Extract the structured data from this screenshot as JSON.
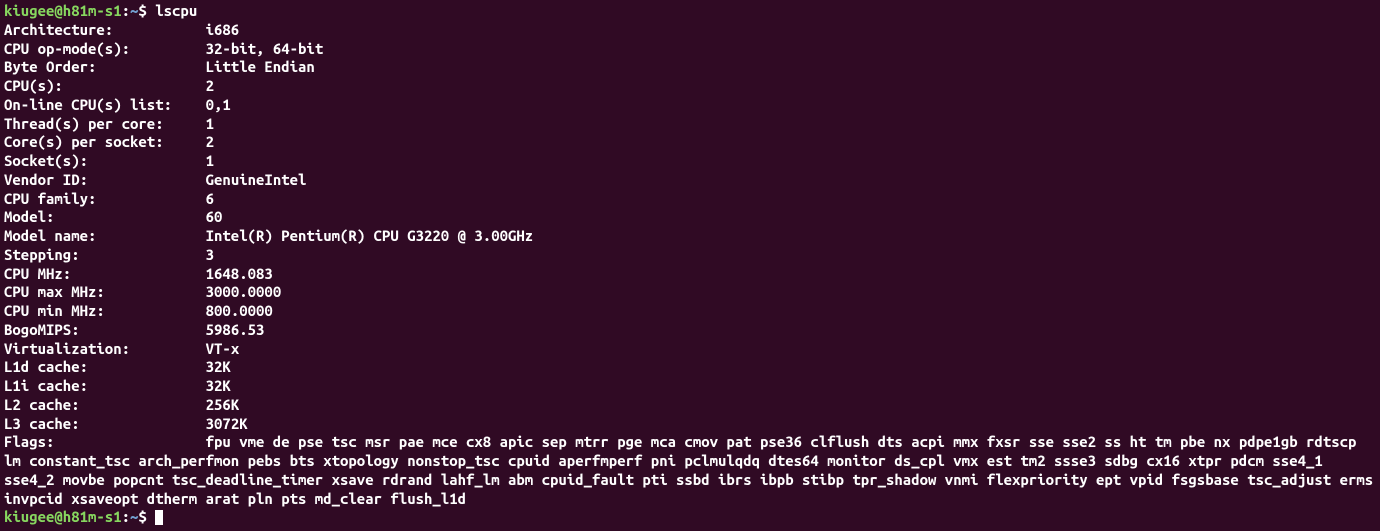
{
  "prompt": {
    "user_host": "kiugee@h81m-s1",
    "path": "~",
    "separator": ":",
    "symbol": "$"
  },
  "command": "lscpu",
  "fields": [
    {
      "label": "Architecture:",
      "value": "i686"
    },
    {
      "label": "CPU op-mode(s):",
      "value": "32-bit, 64-bit"
    },
    {
      "label": "Byte Order:",
      "value": "Little Endian"
    },
    {
      "label": "CPU(s):",
      "value": "2"
    },
    {
      "label": "On-line CPU(s) list:",
      "value": "0,1"
    },
    {
      "label": "Thread(s) per core:",
      "value": "1"
    },
    {
      "label": "Core(s) per socket:",
      "value": "2"
    },
    {
      "label": "Socket(s):",
      "value": "1"
    },
    {
      "label": "Vendor ID:",
      "value": "GenuineIntel"
    },
    {
      "label": "CPU family:",
      "value": "6"
    },
    {
      "label": "Model:",
      "value": "60"
    },
    {
      "label": "Model name:",
      "value": "Intel(R) Pentium(R) CPU G3220 @ 3.00GHz"
    },
    {
      "label": "Stepping:",
      "value": "3"
    },
    {
      "label": "CPU MHz:",
      "value": "1648.083"
    },
    {
      "label": "CPU max MHz:",
      "value": "3000.0000"
    },
    {
      "label": "CPU min MHz:",
      "value": "800.0000"
    },
    {
      "label": "BogoMIPS:",
      "value": "5986.53"
    },
    {
      "label": "Virtualization:",
      "value": "VT-x"
    },
    {
      "label": "L1d cache:",
      "value": "32K"
    },
    {
      "label": "L1i cache:",
      "value": "32K"
    },
    {
      "label": "L2 cache:",
      "value": "256K"
    },
    {
      "label": "L3 cache:",
      "value": "3072K"
    }
  ],
  "flags_label": "Flags:",
  "flags_value": "fpu vme de pse tsc msr pae mce cx8 apic sep mtrr pge mca cmov pat pse36 clflush dts acpi mmx fxsr sse sse2 ss ht tm pbe nx pdpe1gb rdtscp lm constant_tsc arch_perfmon pebs bts xtopology nonstop_tsc cpuid aperfmperf pni pclmulqdq dtes64 monitor ds_cpl vmx est tm2 ssse3 sdbg cx16 xtpr pdcm sse4_1 sse4_2 movbe popcnt tsc_deadline_timer xsave rdrand lahf_lm abm cpuid_fault pti ssbd ibrs ibpb stibp tpr_shadow vnmi flexpriority ept vpid fsgsbase tsc_adjust erms invpcid xsaveopt dtherm arat pln pts md_clear flush_l1d"
}
